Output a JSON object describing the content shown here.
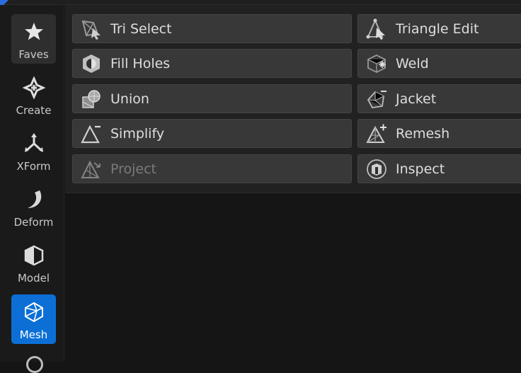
{
  "sidebar": {
    "items": [
      {
        "label": "Faves",
        "icon": "star-icon"
      },
      {
        "label": "Create",
        "icon": "create-icon"
      },
      {
        "label": "XForm",
        "icon": "xform-icon"
      },
      {
        "label": "Deform",
        "icon": "deform-icon"
      },
      {
        "label": "Model",
        "icon": "model-icon"
      },
      {
        "label": "Mesh",
        "icon": "mesh-icon",
        "active": true
      }
    ]
  },
  "tools": [
    {
      "label": "Tri Select",
      "icon": "tri-select-icon"
    },
    {
      "label": "Triangle Edit",
      "icon": "triangle-edit-icon"
    },
    {
      "label": "Fill Holes",
      "icon": "fill-holes-icon"
    },
    {
      "label": "Weld",
      "icon": "weld-icon"
    },
    {
      "label": "Union",
      "icon": "union-icon"
    },
    {
      "label": "Jacket",
      "icon": "jacket-icon"
    },
    {
      "label": "Simplify",
      "icon": "simplify-icon"
    },
    {
      "label": "Remesh",
      "icon": "remesh-icon"
    },
    {
      "label": "Project",
      "icon": "project-icon",
      "disabled": true
    },
    {
      "label": "Inspect",
      "icon": "inspect-icon"
    }
  ],
  "colors": {
    "accent": "#0b6fd6",
    "panel": "#212121",
    "button": "#383838",
    "text": "#dedede"
  }
}
